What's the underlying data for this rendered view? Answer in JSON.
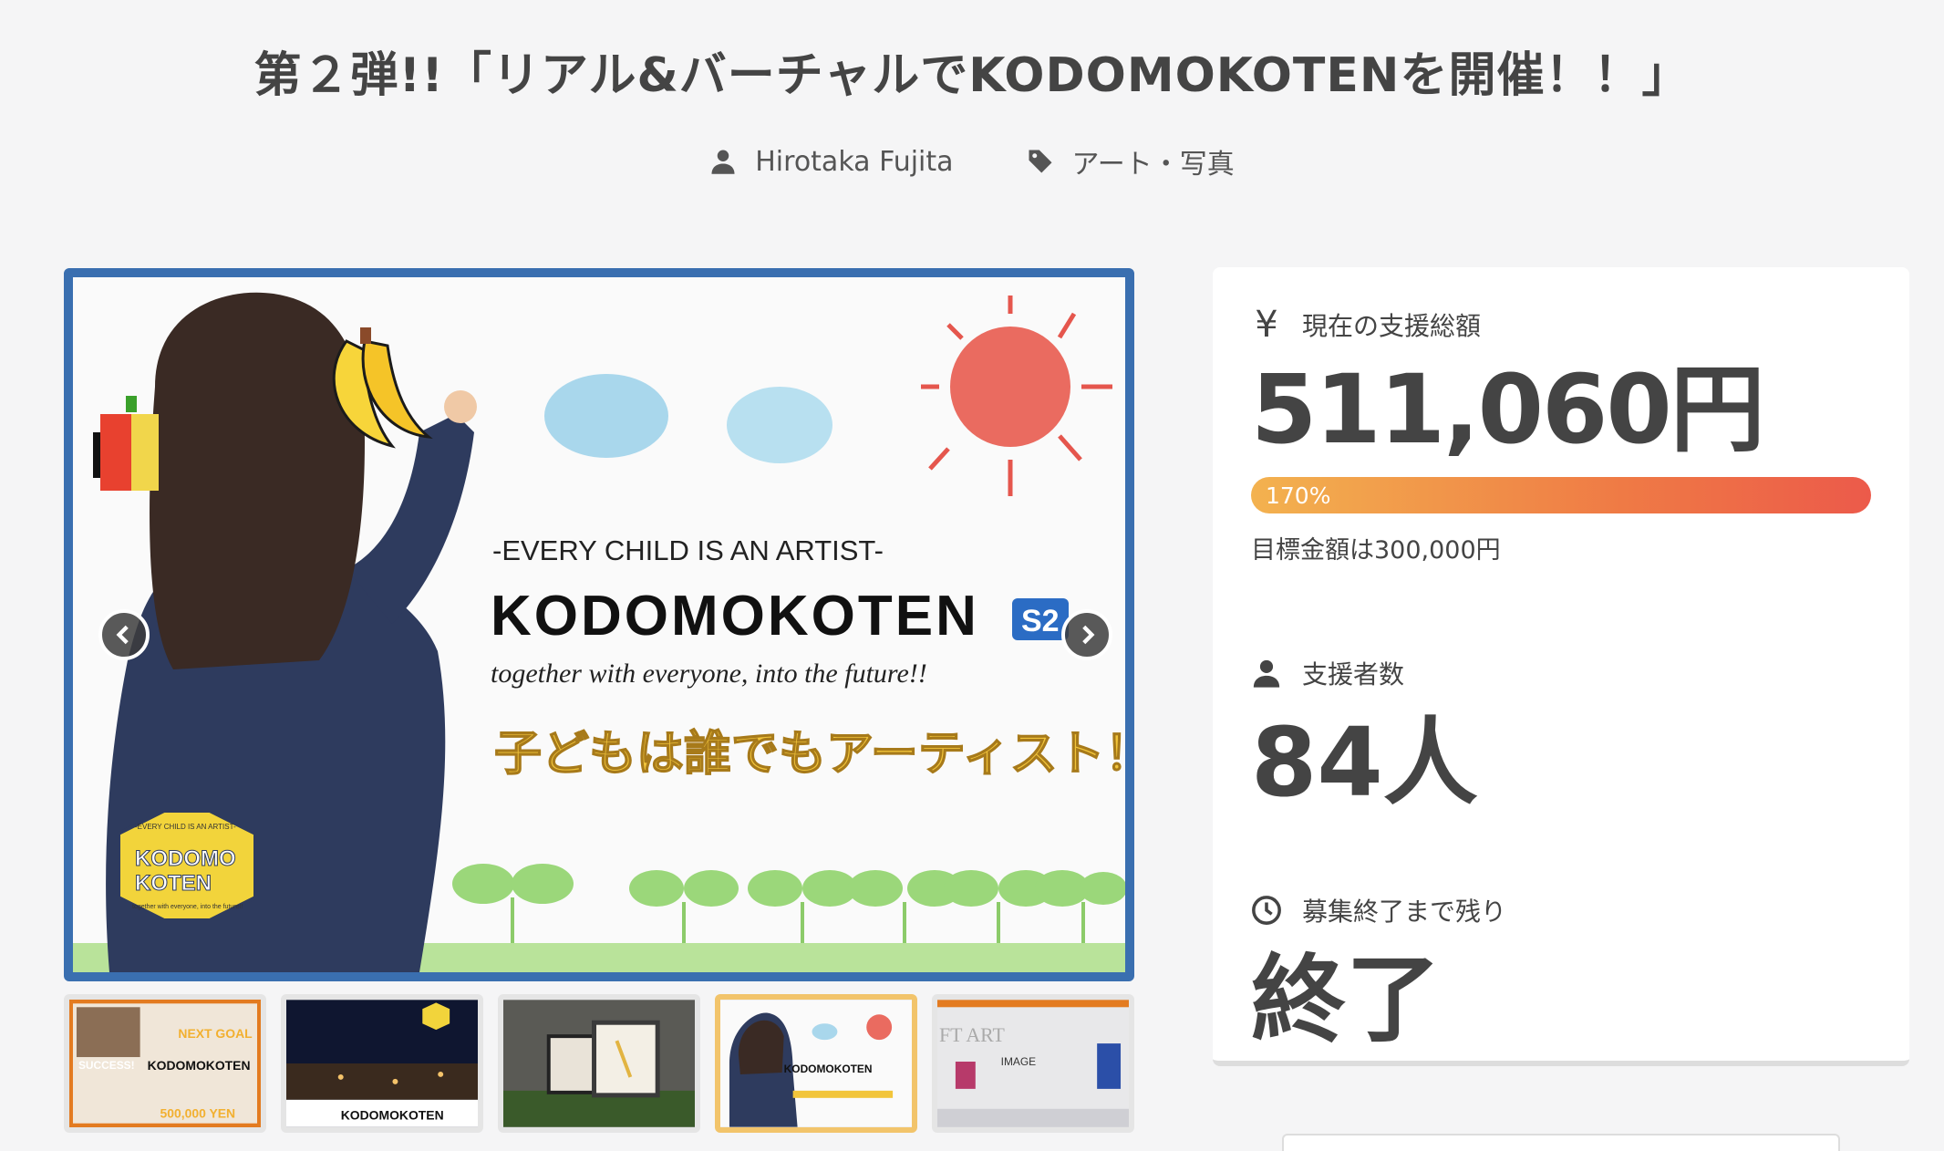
{
  "title": "第２弾!!「リアル&バーチャルでKODOMOKOTENを開催！！」",
  "meta": {
    "author": "Hirotaka Fujita",
    "category": "アート・写真"
  },
  "hero": {
    "tagline": "-EVERY CHILD IS AN ARTIST-",
    "brand": "KODOMOKOTEN",
    "badge": "S2",
    "subtitle": "together with everyone, into the future!!",
    "catchphrase": "子どもは誰でもアーティスト！",
    "hex_line1": "KODOMO",
    "hex_line2": "KOTEN",
    "hex_small_top": "-EVERY CHILD IS AN ARTIST-",
    "hex_small_bottom": "together with everyone, into the future!!"
  },
  "thumbnails": [
    {
      "name": "success",
      "text1": "SUCCESS!",
      "text2": "KODOMOKOTEN",
      "text3": "500,000 YEN",
      "text4": "NEXT GOAL",
      "active": false
    },
    {
      "name": "night-view",
      "text1": "KODOMOKOTEN",
      "active": false
    },
    {
      "name": "frames",
      "active": false
    },
    {
      "name": "hero",
      "text1": "KODOMOKOTEN",
      "active": true
    },
    {
      "name": "virtual-gallery",
      "text1": "FT ART",
      "text2": "IMAGE",
      "active": false
    }
  ],
  "stats": {
    "raised_label": "現在の支援総額",
    "raised_amount": "511,060円",
    "progress_percent": 170,
    "progress_label": "170%",
    "goal_text": "目標金額は300,000円",
    "backers_label": "支援者数",
    "backers_count": "84人",
    "remaining_label": "募集終了まで残り",
    "remaining_value": "終了"
  },
  "colors": {
    "frame": "#3a6fb0",
    "progress_start": "#f3b24f",
    "progress_end": "#ec5a4a",
    "active_thumb": "#f2c46b"
  }
}
